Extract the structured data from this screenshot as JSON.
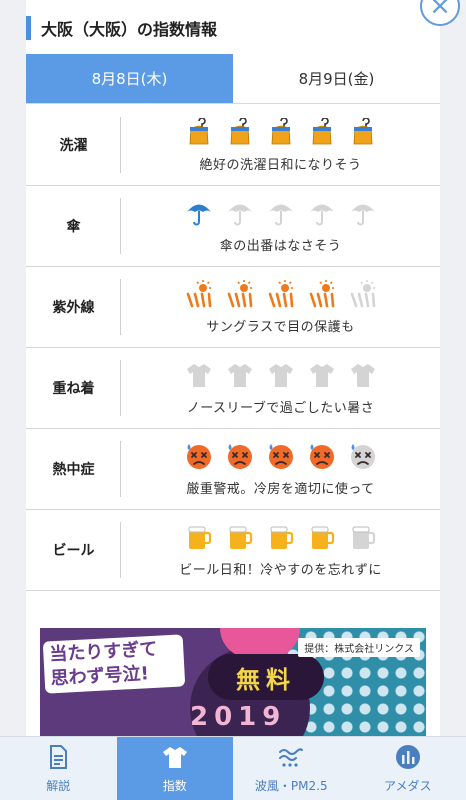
{
  "header": {
    "title": "大阪（大阪）の指数情報"
  },
  "close": {
    "label": "×"
  },
  "tabs": [
    {
      "label": "8月8日(木)",
      "active": true
    },
    {
      "label": "8月9日(金)",
      "active": false
    }
  ],
  "rows": [
    {
      "label": "洗濯",
      "icon": "laundry-icon",
      "level": 5,
      "max": 5,
      "desc": "絶好の洗濯日和になりそう",
      "color": "#f0a21a"
    },
    {
      "label": "傘",
      "icon": "umbrella-icon",
      "level": 1,
      "max": 5,
      "desc": "傘の出番はなさそう",
      "color": "#2b7fd0"
    },
    {
      "label": "紫外線",
      "icon": "uv-icon",
      "level": 4,
      "max": 5,
      "desc": "サングラスで目の保護も",
      "color": "#f07a1a"
    },
    {
      "label": "重ね着",
      "icon": "clothing-icon",
      "level": 0,
      "max": 5,
      "desc": "ノースリーブで過ごしたい暑さ",
      "color": "#c8c8c8"
    },
    {
      "label": "熱中症",
      "icon": "heatstroke-face-icon",
      "level": 4,
      "max": 5,
      "desc": "厳重警戒。冷房を適切に使って",
      "color": "#f06a2a"
    },
    {
      "label": "ビール",
      "icon": "beer-icon",
      "level": 4,
      "max": 5,
      "desc": "ビール日和！冷やすのを忘れずに",
      "color": "#f5b21c"
    }
  ],
  "ad": {
    "catch": "当たりすぎて 思わず号泣!",
    "free": "無料",
    "year": "2019",
    "sponsor": "提供：株式会社リンクス"
  },
  "nav": [
    {
      "label": "解説",
      "icon": "document-icon",
      "active": false
    },
    {
      "label": "指数",
      "icon": "shirt-icon",
      "active": true
    },
    {
      "label": "波風・PM2.5",
      "icon": "wave-icon",
      "active": false
    },
    {
      "label": "アメダス",
      "icon": "amedas-icon",
      "active": false
    }
  ]
}
